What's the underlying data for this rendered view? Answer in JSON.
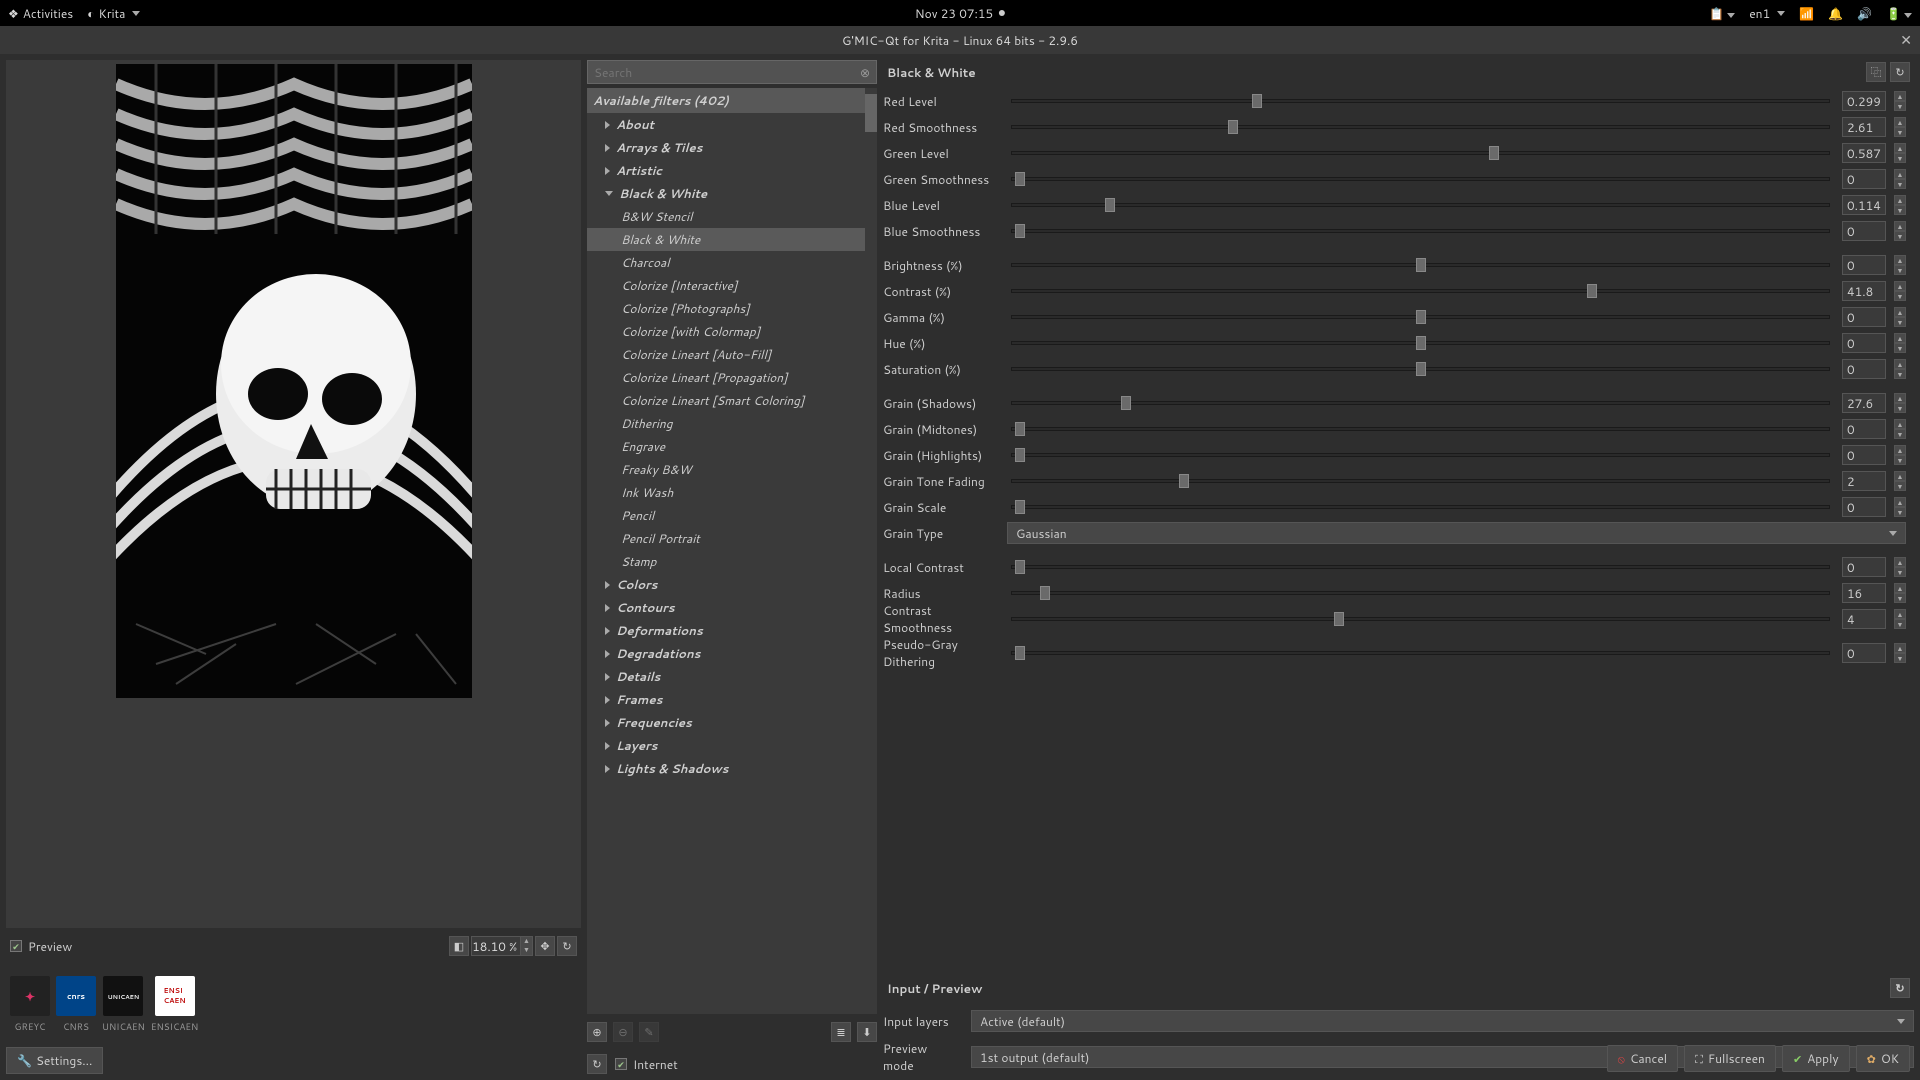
{
  "topbar": {
    "activities": "Activities",
    "app": "Krita",
    "clock": "Nov 23  07:15",
    "lang": "en1"
  },
  "titlebar": {
    "title": "G'MIC-Qt for Krita - Linux 64 bits - 2.9.6"
  },
  "preview": {
    "checkbox_label": "Preview",
    "zoom": "18.10 %"
  },
  "logos": [
    "GREYC",
    "CNRS",
    "UNICAEN",
    "ENSICAEN"
  ],
  "settings_btn": "Settings...",
  "search": {
    "placeholder": "Search"
  },
  "tree": {
    "header": "Available filters (402)",
    "categories": [
      {
        "label": "About",
        "expanded": false
      },
      {
        "label": "Arrays & Tiles",
        "expanded": false
      },
      {
        "label": "Artistic",
        "expanded": false
      },
      {
        "label": "Black & White",
        "expanded": true,
        "children": [
          "B&W Stencil",
          "Black & White",
          "Charcoal",
          "Colorize [Interactive]",
          "Colorize [Photographs]",
          "Colorize [with Colormap]",
          "Colorize Lineart [Auto-Fill]",
          "Colorize Lineart [Propagation]",
          "Colorize Lineart [Smart Coloring]",
          "Dithering",
          "Engrave",
          "Freaky B&W",
          "Ink Wash",
          "Pencil",
          "Pencil Portrait",
          "Stamp"
        ],
        "selected": "Black & White"
      },
      {
        "label": "Colors",
        "expanded": false
      },
      {
        "label": "Contours",
        "expanded": false
      },
      {
        "label": "Deformations",
        "expanded": false
      },
      {
        "label": "Degradations",
        "expanded": false
      },
      {
        "label": "Details",
        "expanded": false
      },
      {
        "label": "Frames",
        "expanded": false
      },
      {
        "label": "Frequencies",
        "expanded": false
      },
      {
        "label": "Layers",
        "expanded": false
      },
      {
        "label": "Lights & Shadows",
        "expanded": false
      }
    ]
  },
  "internet_label": "Internet",
  "params": {
    "title": "Black & White",
    "sliders": [
      {
        "label": "Red Level",
        "value": "0.299",
        "pos": 30
      },
      {
        "label": "Red Smoothness",
        "value": "2.61",
        "pos": 27
      },
      {
        "label": "Green Level",
        "value": "0.587",
        "pos": 59
      },
      {
        "label": "Green Smoothness",
        "value": "0",
        "pos": 1
      },
      {
        "label": "Blue Level",
        "value": "0.114",
        "pos": 12
      },
      {
        "label": "Blue Smoothness",
        "value": "0",
        "pos": 1
      },
      {
        "label": "Brightness (%)",
        "value": "0",
        "pos": 50,
        "gap_before": true
      },
      {
        "label": "Contrast (%)",
        "value": "41.8",
        "pos": 71
      },
      {
        "label": "Gamma (%)",
        "value": "0",
        "pos": 50
      },
      {
        "label": "Hue (%)",
        "value": "0",
        "pos": 50
      },
      {
        "label": "Saturation (%)",
        "value": "0",
        "pos": 50
      },
      {
        "label": "Grain (Shadows)",
        "value": "27.6",
        "pos": 14,
        "gap_before": true
      },
      {
        "label": "Grain (Midtones)",
        "value": "0",
        "pos": 1
      },
      {
        "label": "Grain (Highlights)",
        "value": "0",
        "pos": 1
      },
      {
        "label": "Grain Tone Fading",
        "value": "2",
        "pos": 21
      },
      {
        "label": "Grain Scale",
        "value": "0",
        "pos": 1
      }
    ],
    "grain_type_label": "Grain Type",
    "grain_type_value": "Gaussian",
    "sliders2": [
      {
        "label": "Local Contrast",
        "value": "0",
        "pos": 1,
        "gap_before": true
      },
      {
        "label": "Radius",
        "value": "16",
        "pos": 4
      },
      {
        "label": "Contrast Smoothness",
        "value": "4",
        "pos": 40
      },
      {
        "label": "Pseudo-Gray Dithering",
        "value": "0",
        "pos": 1,
        "gap_before": true
      }
    ]
  },
  "input_preview": {
    "header": "Input / Preview",
    "input_layers_label": "Input layers",
    "input_layers_value": "Active (default)",
    "preview_mode_label": "Preview mode",
    "preview_mode_value": "1st output (default)"
  },
  "buttons": {
    "cancel": "Cancel",
    "fullscreen": "Fullscreen",
    "apply": "Apply",
    "ok": "OK"
  }
}
